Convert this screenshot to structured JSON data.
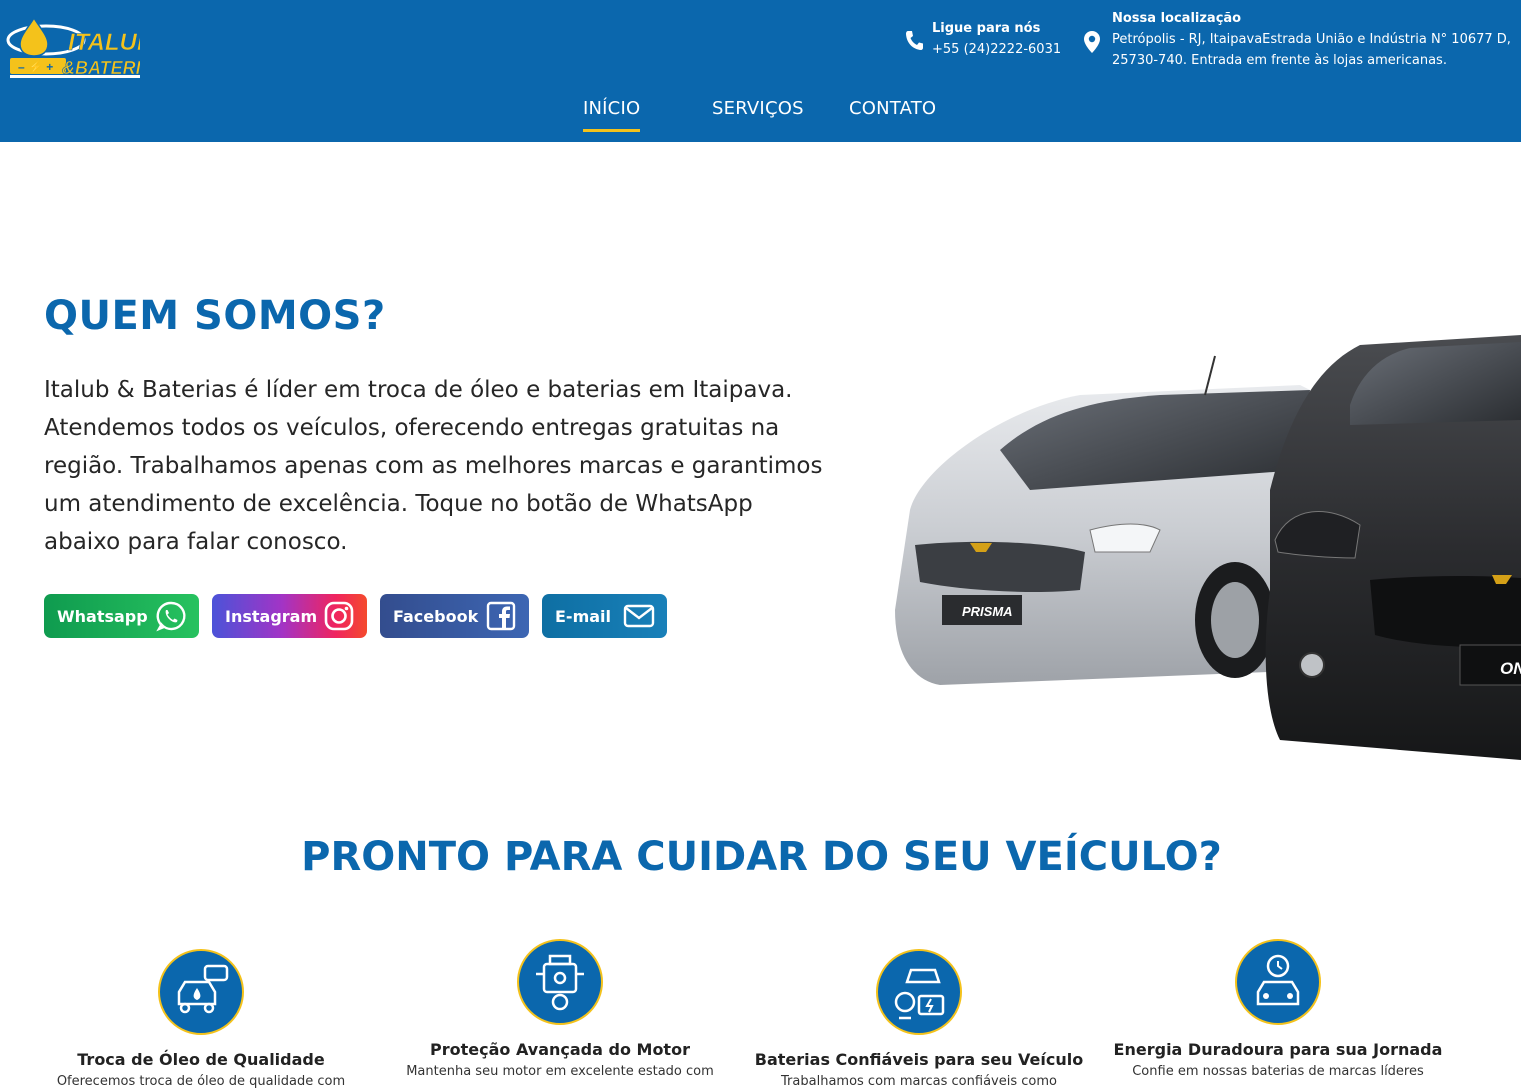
{
  "header": {
    "logo_line1": "ITALUB",
    "logo_line2": "&BATERIAS",
    "phone_title": "Ligue para nós",
    "phone_value": "+55 (24)2222-6031",
    "location_title": "Nossa localização",
    "location_value": "Petrópolis - RJ, ItaipavaEstrada União e Indústria N° 10677 D, 25730-740. Entrada em frente às lojas americanas.",
    "brand_color": "#0b67ad",
    "accent_color": "#f4c21b"
  },
  "nav": {
    "items": [
      {
        "label": "INÍCIO",
        "active": true
      },
      {
        "label": "SERVIÇOS",
        "active": false
      },
      {
        "label": "CONTATO",
        "active": false
      }
    ]
  },
  "about": {
    "title": "QUEM SOMOS?",
    "text": "Italub & Baterias é líder em troca de óleo e baterias em Itaipava. Atendemos todos os veículos, oferecendo entregas gratuitas na região. Trabalhamos apenas com as melhores marcas e garantimos um atendimento de excelência. Toque no botão de WhatsApp abaixo para falar conosco.",
    "buttons": {
      "whatsapp": "Whatsapp",
      "instagram": "Instagram",
      "facebook": "Facebook",
      "email": "E-mail"
    },
    "car_plate_left": "PRISMA",
    "car_plate_right": "ON"
  },
  "ready": {
    "title": "PRONTO PARA CUIDAR DO SEU VEÍCULO?",
    "features": [
      {
        "title": "Troca de Óleo de Qualidade",
        "desc": "Oferecemos troca de óleo de qualidade com",
        "icon": "oil-change-icon"
      },
      {
        "title": "Proteção Avançada do Motor",
        "desc": "Mantenha seu motor em excelente estado com",
        "icon": "engine-icon"
      },
      {
        "title": "Baterias Confiáveis para seu Veículo",
        "desc": "Trabalhamos com marcas confiáveis como",
        "icon": "battery-mechanic-icon"
      },
      {
        "title": "Energia Duradoura para sua Jornada",
        "desc": "Confie em nossas baterias de marcas líderes",
        "icon": "car-timer-icon"
      }
    ]
  }
}
